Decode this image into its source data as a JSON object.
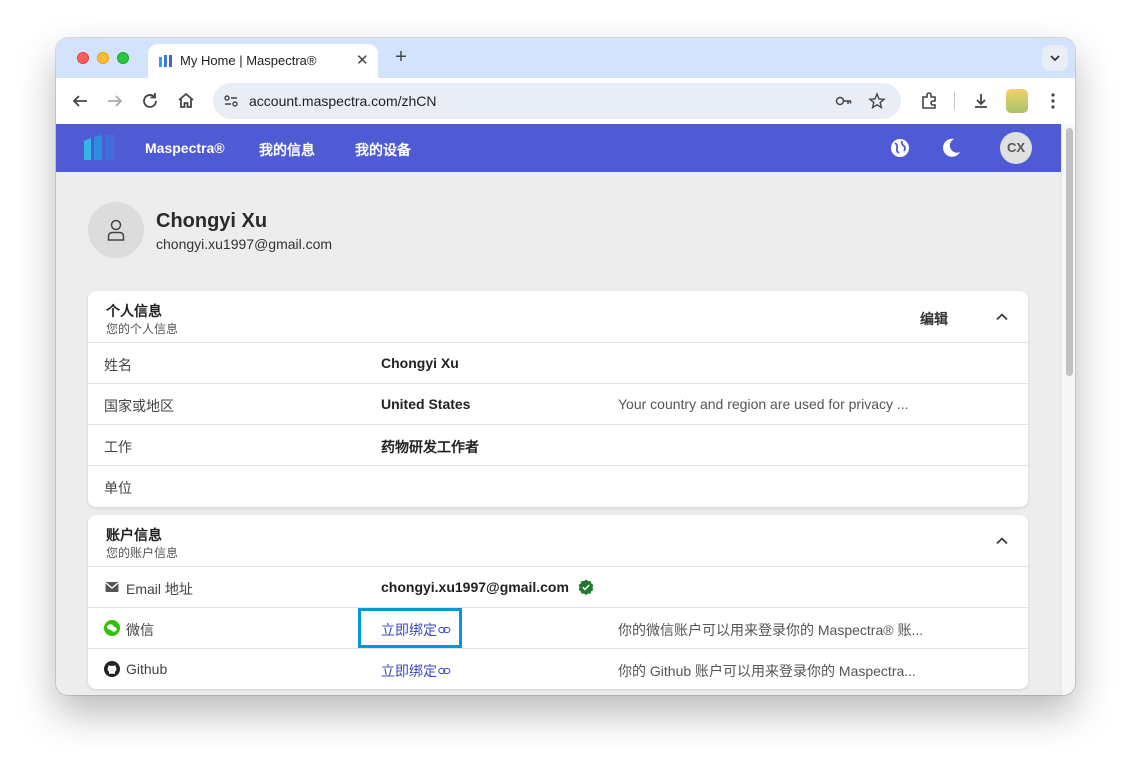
{
  "browser": {
    "tab_title": "My Home | Maspectra®",
    "url": "account.maspectra.com/zhCN"
  },
  "appbar": {
    "brand": "Maspectra®",
    "nav": [
      "我的信息",
      "我的设备"
    ],
    "avatar_initials": "CX",
    "brand_color": "#4f5bd5"
  },
  "profile": {
    "name": "Chongyi Xu",
    "email": "chongyi.xu1997@gmail.com"
  },
  "personal": {
    "title": "个人信息",
    "subtitle": "您的个人信息",
    "edit_label": "编辑",
    "rows": [
      {
        "label": "姓名",
        "value": "Chongyi Xu",
        "desc": ""
      },
      {
        "label": "国家或地区",
        "value": "United States",
        "desc": "Your country and region are used for privacy ..."
      },
      {
        "label": "工作",
        "value": "药物研发工作者",
        "desc": ""
      },
      {
        "label": "单位",
        "value": "",
        "desc": ""
      }
    ]
  },
  "account": {
    "title": "账户信息",
    "subtitle": "您的账户信息",
    "rows": [
      {
        "label": "Email 地址",
        "icon": "mail-icon",
        "value": "chongyi.xu1997@gmail.com",
        "verified": true
      },
      {
        "label": "微信",
        "icon": "wechat-icon",
        "link": "立即绑定",
        "desc": "你的微信账户可以用来登录你的 Maspectra® 账..."
      },
      {
        "label": "Github",
        "icon": "github-icon",
        "link": "立即绑定",
        "desc": "你的 Github 账户可以用来登录你的 Maspectra..."
      }
    ]
  }
}
